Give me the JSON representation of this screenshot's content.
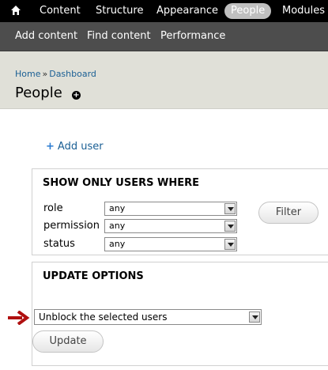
{
  "toolbar": {
    "home_icon": "home-icon",
    "tabs": [
      "Content",
      "Structure",
      "Appearance",
      "People",
      "Modules"
    ],
    "active_tab": "People"
  },
  "shortcuts": [
    "Add content",
    "Find content",
    "Performance"
  ],
  "breadcrumb": {
    "items": [
      "Home",
      "Dashboard"
    ],
    "separator": "»"
  },
  "page": {
    "title": "People",
    "title_icon": "plus-circle-icon"
  },
  "add_user": {
    "label": "Add user",
    "icon": "plus-icon"
  },
  "filter": {
    "legend": "SHOW ONLY USERS WHERE",
    "rows": [
      {
        "label": "role",
        "value": "any"
      },
      {
        "label": "permission",
        "value": "any"
      },
      {
        "label": "status",
        "value": "any"
      }
    ],
    "button": "Filter"
  },
  "update": {
    "legend": "UPDATE OPTIONS",
    "select_value": "Unblock the selected users",
    "button": "Update",
    "pointer_icon": "red-arrow-icon"
  },
  "colors": {
    "toolbar_bg": "#000000",
    "shortcuts_bg": "#4d4d4d",
    "header_bg": "#e0e0d8",
    "link": "#1a5f94",
    "arrow": "#b01010"
  }
}
